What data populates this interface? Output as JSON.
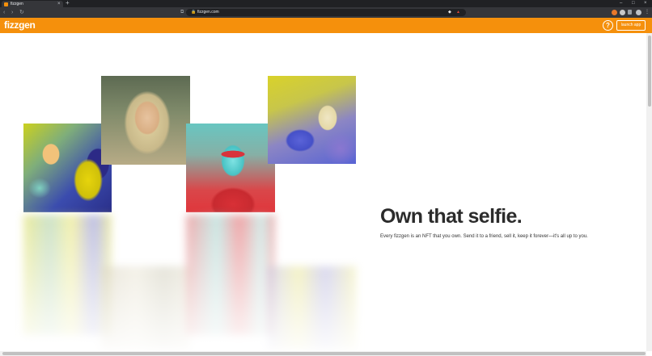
{
  "browser": {
    "tab_title": "fizzgen",
    "tab_close": "×",
    "new_tab": "+",
    "url": "fizzgen.com",
    "nav": {
      "back": "‹",
      "forward": "›",
      "reload": "↻"
    },
    "window": {
      "minimize": "–",
      "maximize": "□",
      "close": "×"
    }
  },
  "header": {
    "logo": "fizzgen",
    "help": "?",
    "launch_label": "launch app",
    "accent_color": "#f5900c"
  },
  "hero": {
    "headline": "Own that selfie.",
    "subtext": "Every fizzgen is an NFT that you own. Send it to a friend, sell it, keep it forever—it's all up to you."
  },
  "photos": [
    {
      "name": "photo-child-with-toy",
      "palette": "yellow-blue"
    },
    {
      "name": "photo-girl-portrait",
      "palette": "sepia-green"
    },
    {
      "name": "photo-man-red-glasses",
      "palette": "red-cyan"
    },
    {
      "name": "photo-dog",
      "palette": "yellow-blue-purple"
    }
  ]
}
